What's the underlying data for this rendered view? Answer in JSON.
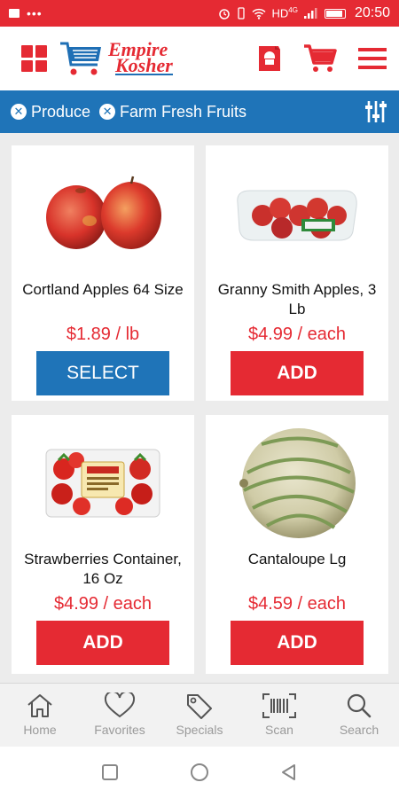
{
  "status_bar": {
    "dots": "•••",
    "network": "HD",
    "network_sup": "4G",
    "time": "20:50"
  },
  "header": {
    "logo_line1": "Empire",
    "logo_line2": "Kosher",
    "icons": [
      "grid-menu-icon",
      "circular-icon",
      "cart-icon",
      "hamburger-menu-icon"
    ],
    "accent_color": "#e52a33",
    "brand_blue": "#1f74b8"
  },
  "filters": {
    "chips": [
      {
        "label": "Produce"
      },
      {
        "label": "Farm Fresh Fruits"
      }
    ]
  },
  "products": [
    {
      "name": "Cortland Apples 64 Size",
      "price": "$1.89 / lb",
      "button": "SELECT"
    },
    {
      "name": "Granny Smith Apples, 3 Lb",
      "price": "$4.99 / each",
      "button": "ADD"
    },
    {
      "name": "Strawberries Container, 16 Oz",
      "price": "$4.99 / each",
      "button": "ADD"
    },
    {
      "name": "Cantaloupe Lg",
      "price": "$4.59 / each",
      "button": "ADD"
    }
  ],
  "bottom_nav": {
    "items": [
      {
        "label": "Home",
        "icon": "home-icon"
      },
      {
        "label": "Favorites",
        "icon": "heart-icon"
      },
      {
        "label": "Specials",
        "icon": "tag-icon"
      },
      {
        "label": "Scan",
        "icon": "barcode-icon"
      },
      {
        "label": "Search",
        "icon": "search-icon"
      }
    ]
  }
}
